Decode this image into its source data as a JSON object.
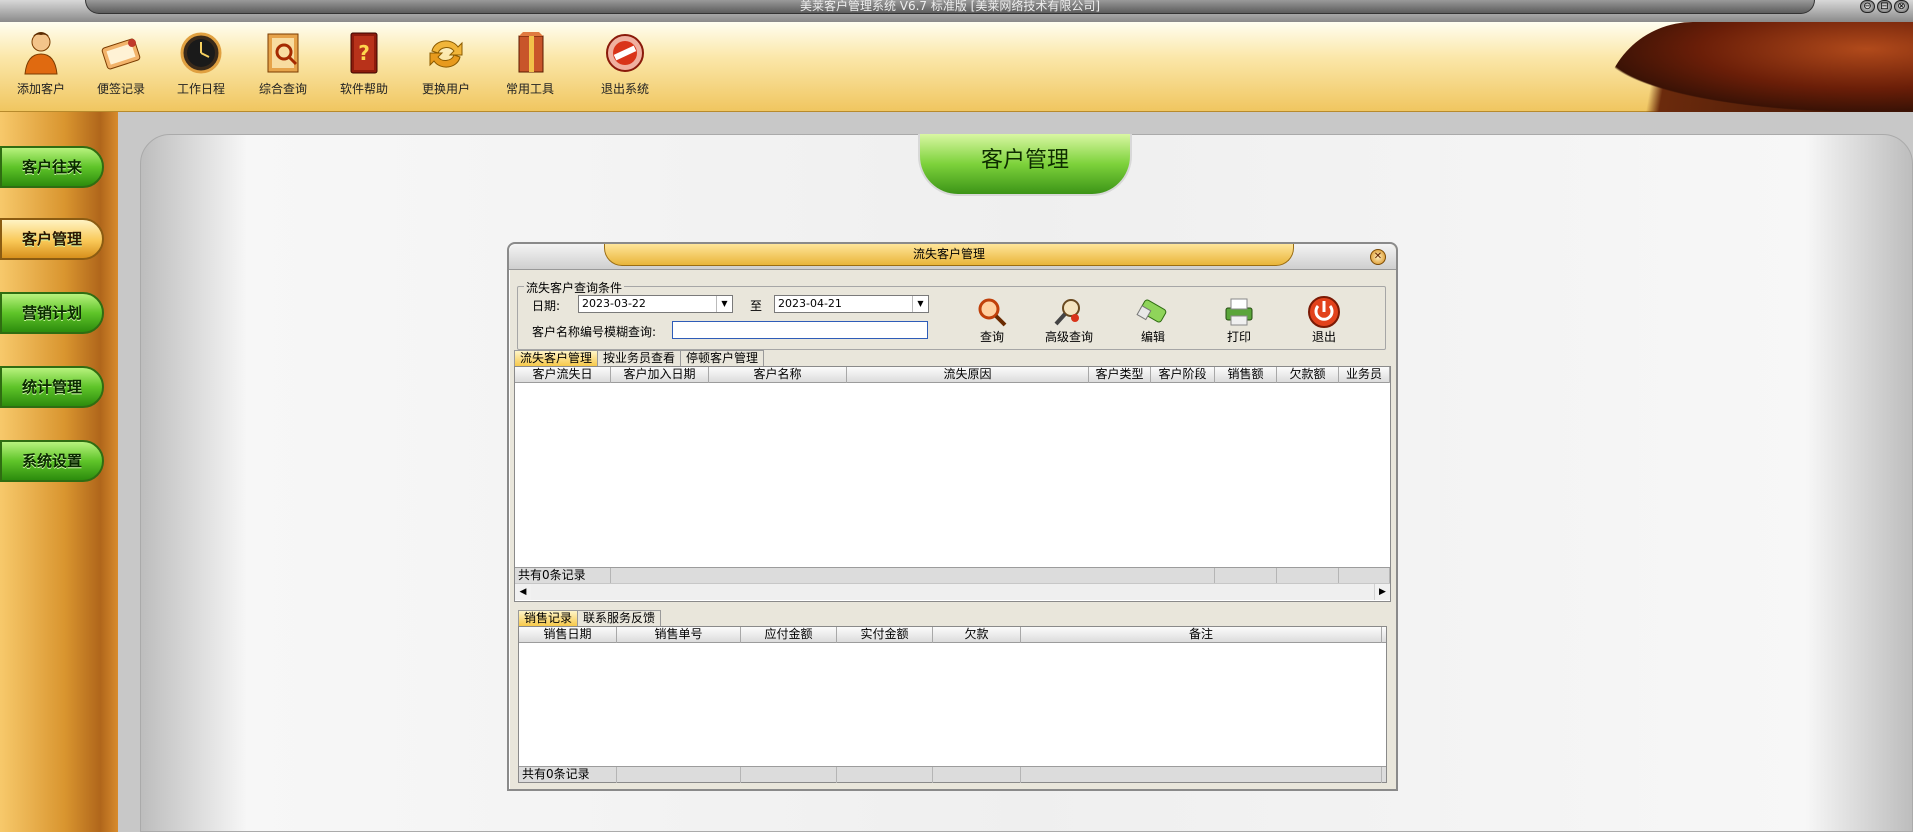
{
  "window": {
    "title": "美莱客户管理系统 V6.7 标准版 [美莱网络技术有限公司]",
    "controls": [
      "⊖",
      "⊟",
      "⊗"
    ]
  },
  "toolbar": {
    "items": [
      {
        "label": "添加客户",
        "icon": "add-customer-icon"
      },
      {
        "label": "便签记录",
        "icon": "notes-icon"
      },
      {
        "label": "工作日程",
        "icon": "schedule-icon"
      },
      {
        "label": "综合查询",
        "icon": "search-book-icon"
      },
      {
        "label": "软件帮助",
        "icon": "help-book-icon"
      },
      {
        "label": "更换用户",
        "icon": "switch-user-icon"
      },
      {
        "label": "常用工具",
        "icon": "tools-icon"
      },
      {
        "label": "退出系统",
        "icon": "exit-icon"
      }
    ]
  },
  "sidebar": {
    "items": [
      {
        "label": "客户往来",
        "active": false
      },
      {
        "label": "客户管理",
        "active": true
      },
      {
        "label": "营销计划",
        "active": false
      },
      {
        "label": "统计管理",
        "active": false
      },
      {
        "label": "系统设置",
        "active": false
      }
    ]
  },
  "main": {
    "tab_title": "客户管理"
  },
  "dialog": {
    "title": "流失客户管理",
    "close": "✕",
    "query": {
      "legend": "流失客户查询条件",
      "date_label": "日期:",
      "date_from": "2023-03-22",
      "to_label": "至",
      "date_to": "2023-04-21",
      "name_label": "客户名称编号模糊查询:",
      "name_value": ""
    },
    "actions": [
      {
        "label": "查询",
        "icon": "magnifier-icon"
      },
      {
        "label": "高级查询",
        "icon": "advanced-search-icon"
      },
      {
        "label": "编辑",
        "icon": "eraser-edit-icon"
      },
      {
        "label": "打印",
        "icon": "printer-icon"
      },
      {
        "label": "退出",
        "icon": "power-icon"
      }
    ],
    "top_tabs": [
      {
        "label": "流失客户管理",
        "active": true
      },
      {
        "label": "按业务员查看",
        "active": false
      },
      {
        "label": "停顿客户管理",
        "active": false
      }
    ],
    "top_grid": {
      "columns": [
        "客户流失日",
        "客户加入日期",
        "客户名称",
        "流失原因",
        "客户类型",
        "客户阶段",
        "销售额",
        "欠款额",
        "业务员"
      ],
      "footer": "共有0条记录"
    },
    "bottom_tabs": [
      {
        "label": "销售记录",
        "active": true
      },
      {
        "label": "联系服务反馈",
        "active": false
      }
    ],
    "bottom_grid": {
      "columns": [
        "销售日期",
        "销售单号",
        "应付金额",
        "实付金额",
        "欠款",
        "备注"
      ],
      "footer": "共有0条记录"
    }
  }
}
